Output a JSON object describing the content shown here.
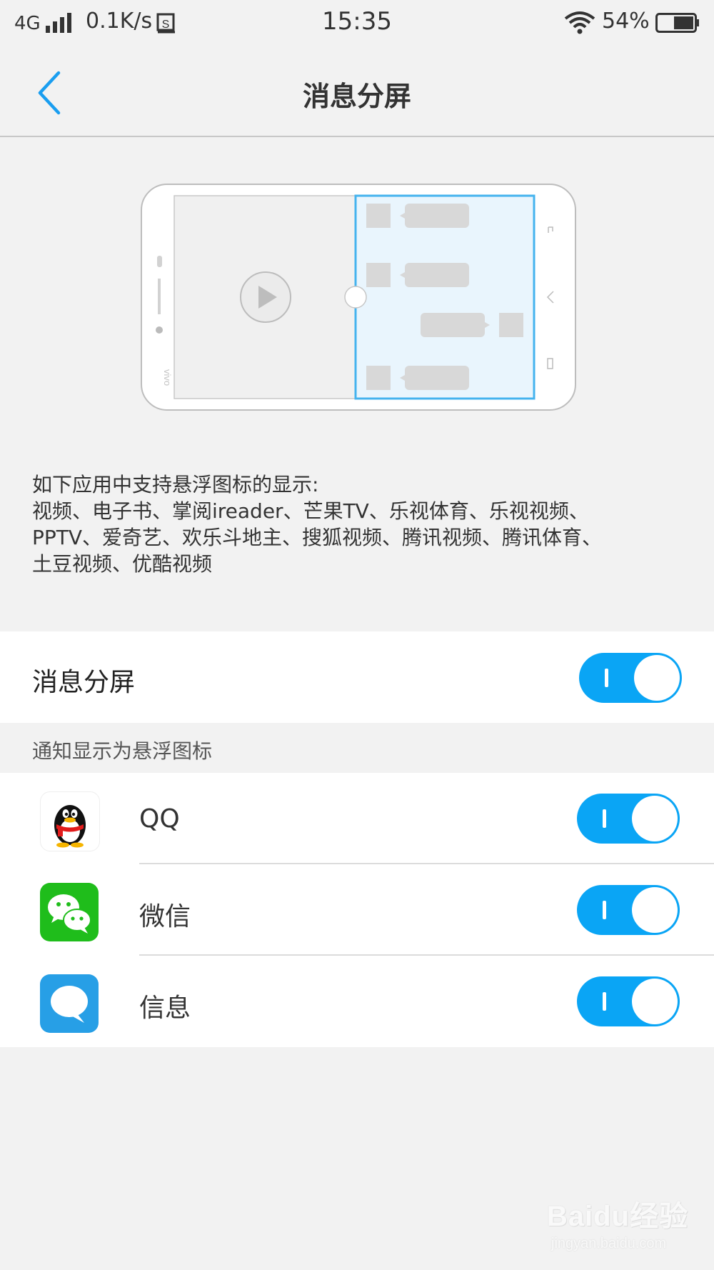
{
  "status_bar": {
    "network": "4G",
    "speed": "0.1K/s",
    "time": "15:35",
    "battery_percent": "54%",
    "icons": [
      "signal-icon",
      "sim-icon",
      "wifi-icon",
      "battery-icon"
    ]
  },
  "header": {
    "title": "消息分屏",
    "back_icon": "chevron-left-icon"
  },
  "description": {
    "heading": "如下应用中支持悬浮图标的显示:",
    "lines": [
      "视频、电子书、掌阅ireader、芒果TV、乐视体育、乐视视频、",
      "PPTV、爱奇艺、欢乐斗地主、搜狐视频、腾讯视频、腾讯体育、",
      "土豆视频、优酷视频"
    ]
  },
  "main_toggle": {
    "label": "消息分屏",
    "on": true
  },
  "section": {
    "label": "通知显示为悬浮图标"
  },
  "apps": [
    {
      "name": "QQ",
      "icon": "qq-penguin-icon",
      "on": true
    },
    {
      "name": "微信",
      "icon": "wechat-icon",
      "on": true
    },
    {
      "name": "信息",
      "icon": "messages-icon",
      "on": true
    }
  ],
  "watermark": {
    "brand": "Baidu经验",
    "url": "jingyan.baidu.com"
  },
  "colors": {
    "accent": "#0aa5f5",
    "background": "#f2f2f2",
    "card": "#ffffff"
  }
}
